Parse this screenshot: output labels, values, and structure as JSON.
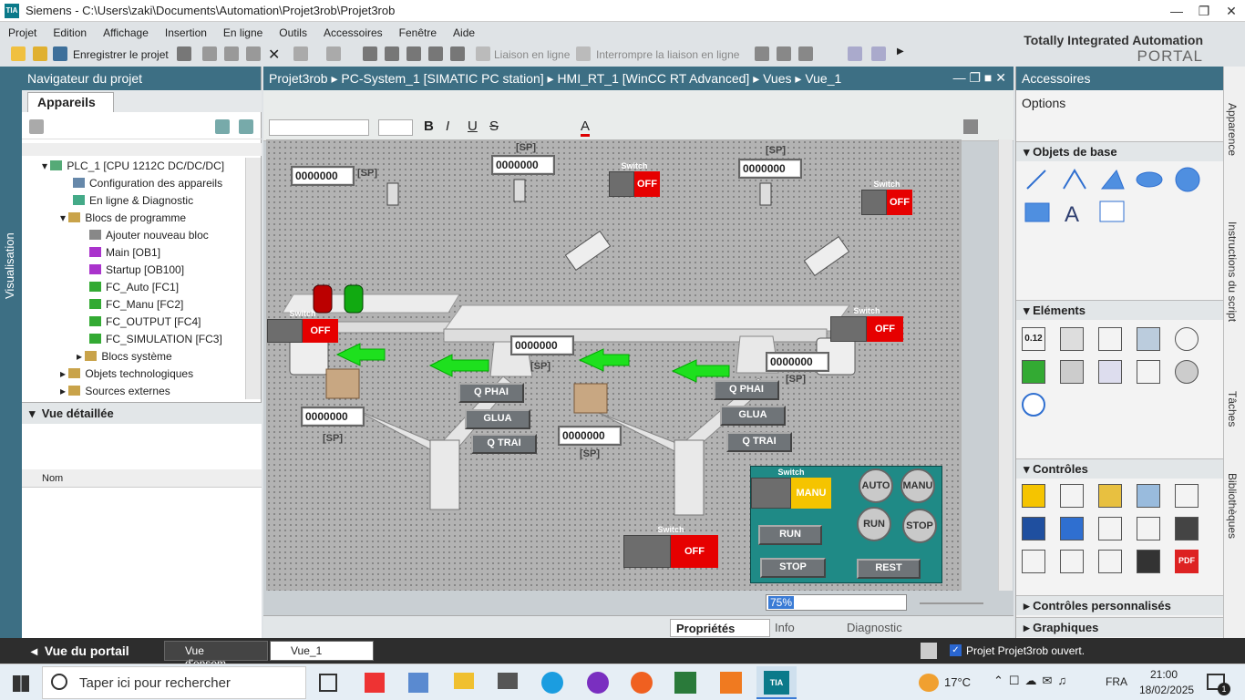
{
  "window": {
    "title": "Siemens  -  C:\\Users\\zaki\\Documents\\Automation\\Projet3rob\\Projet3rob",
    "logo": "TIA"
  },
  "menu": [
    "Projet",
    "Edition",
    "Affichage",
    "Insertion",
    "En ligne",
    "Outils",
    "Accessoires",
    "Fenêtre",
    "Aide"
  ],
  "toolbar": {
    "save": "Enregistrer le projet",
    "online": "Liaison en ligne",
    "offline": "Interrompre la liaison en ligne"
  },
  "brand": {
    "line1": "Totally Integrated Automation",
    "line2": "PORTAL"
  },
  "left_vtab": "Visualisation",
  "nav": {
    "title": "Navigateur du projet",
    "tab": "Appareils",
    "items": [
      "PLC_1 [CPU 1212C DC/DC/DC]",
      "Configuration des appareils",
      "En ligne & Diagnostic",
      "Blocs de programme",
      "Ajouter nouveau bloc",
      "Main [OB1]",
      "Startup [OB100]",
      "FC_Auto [FC1]",
      "FC_Manu [FC2]",
      "FC_OUTPUT [FC4]",
      "FC_SIMULATION [FC3]",
      "Blocs système",
      "Objets technologiques",
      "Sources externes"
    ]
  },
  "detail": {
    "title": "Vue détaillée",
    "col": "Nom"
  },
  "editor": {
    "breadcrumb": "Projet3rob  ▸  PC-System_1 [SIMATIC PC station]  ▸  HMI_RT_1 [WinCC RT Advanced]  ▸  Vues  ▸  Vue_1",
    "zoom": "75%",
    "tabs": {
      "props": "Propriétés",
      "info": "Info",
      "diag": "Diagnostic"
    }
  },
  "hmi": {
    "value": "0000000",
    "sp": "[SP]",
    "switch": "Switch",
    "off": "OFF",
    "manu": "MANU",
    "qphai": "Q PHAI",
    "glua": "GLUA",
    "qtrai": "Q TRAI",
    "auto": "AUTO",
    "manu_btn": "MANU",
    "run_r": "RUN",
    "stop_r": "STOP",
    "run": "RUN",
    "stop": "STOP",
    "rest": "REST"
  },
  "acc": {
    "title": "Accessoires",
    "options": "Options",
    "basic": "Objets de base",
    "elements": "Eléments",
    "controls": "Contrôles",
    "custom": "Contrôles personnalisés",
    "graphics": "Graphiques"
  },
  "right_vtabs": [
    "Apparence",
    "Instructions du script",
    "Tâches",
    "Bibliothèques"
  ],
  "status": {
    "portal": "Vue du portail",
    "tab1": "Vue d'ensem...",
    "tab2": "Vue_1",
    "msg": "Projet Projet3rob ouvert."
  },
  "taskbar": {
    "search": "Taper ici pour rechercher",
    "weather": "17°C",
    "lang": "FRA",
    "time": "21:00",
    "date": "18/02/2025",
    "badge": "1"
  }
}
